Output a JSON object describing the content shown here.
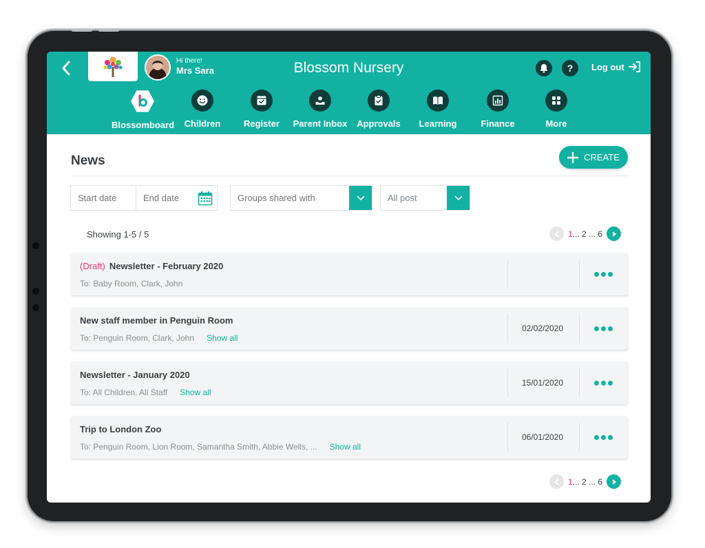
{
  "header": {
    "greeting_small": "Hi there!",
    "user_name": "Mrs Sara",
    "app_title": "Blossom Nursery",
    "logout_label": "Log out",
    "help_glyph": "?"
  },
  "nav": {
    "items": [
      {
        "label": "Blossomboard",
        "icon": "blossom-logo-icon"
      },
      {
        "label": "Children",
        "icon": "smiley-icon"
      },
      {
        "label": "Register",
        "icon": "register-box-icon"
      },
      {
        "label": "Parent Inbox",
        "icon": "inbox-icon"
      },
      {
        "label": "Approvals",
        "icon": "clipboard-check-icon"
      },
      {
        "label": "Learning",
        "icon": "book-icon"
      },
      {
        "label": "Finance",
        "icon": "chart-icon"
      },
      {
        "label": "More",
        "icon": "grid-icon"
      }
    ]
  },
  "page": {
    "title": "News",
    "create_label": "CREATE"
  },
  "filters": {
    "start_date_placeholder": "Start date",
    "end_date_placeholder": "End date",
    "groups_placeholder": "Groups shared with",
    "post_filter_value": "All post"
  },
  "pagination": {
    "showing": "Showing 1-5 / 5",
    "current": "1",
    "rest": "... 2 ... 6"
  },
  "posts": [
    {
      "draft": "(Draft)",
      "title": "Newsletter - February 2020",
      "to": "To: Baby Room, Clark, John",
      "date": "",
      "show_all": ""
    },
    {
      "draft": "",
      "title": "New staff member in Penguin Room",
      "to": "To: Penguin Room, Clark, John",
      "date": "02/02/2020",
      "show_all": "Show all"
    },
    {
      "draft": "",
      "title": "Newsletter - January 2020",
      "to": "To: All Children, All Staff",
      "date": "15/01/2020",
      "show_all": "Show all"
    },
    {
      "draft": "",
      "title": "Trip to London Zoo",
      "to": "To: Penguin Room, Lion Room, Samantha Smith, Abbie Wells, ...",
      "date": "06/01/2020",
      "show_all": "Show all"
    }
  ],
  "colors": {
    "primary": "#12b1a1",
    "icon_dark": "#0e3e3a",
    "accent_pink": "#e0357a"
  }
}
